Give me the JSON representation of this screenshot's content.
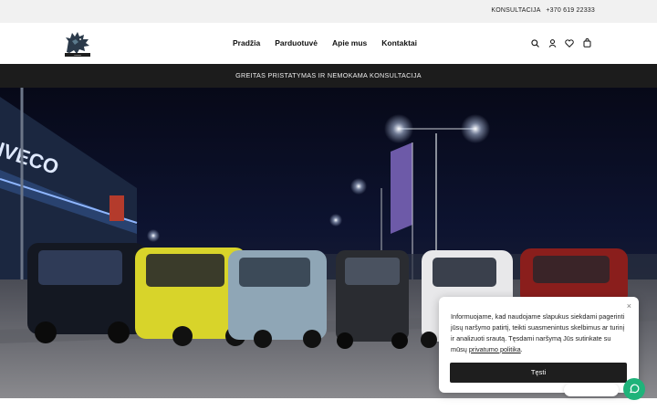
{
  "topbar": {
    "label": "KONSULTACIJA",
    "phone": "+370 619 22333"
  },
  "header": {
    "logo_icon": "dragon-logo-icon",
    "nav": [
      {
        "label": "Pradžia"
      },
      {
        "label": "Parduotuvė"
      },
      {
        "label": "Apie mus"
      },
      {
        "label": "Kontaktai"
      }
    ],
    "icons": [
      "search-icon",
      "account-icon",
      "wishlist-heart-icon",
      "cart-bag-icon"
    ]
  },
  "announcement": {
    "icon": "",
    "text": "GREITAS PRISTATYMAS IR NEMOKAMA KONSULTACIJA"
  },
  "hero": {
    "building_sign": "IVECO",
    "image": "row of small electric city cars at night in a parking lot"
  },
  "cookie": {
    "text": "Informuojame, kad naudojame slapukus siekdami pagerinti jūsų naršymo patirtį, teikti suasmenintus skelbimus ar turinį ir analizuoti srautą. Tęsdami naršymą Jūs sutinkate su mūsų",
    "link": "privatumo politika",
    "link_suffix": ".",
    "button": "Tęsti",
    "close": "×"
  },
  "colors": {
    "topbar_bg": "#f1f1f1",
    "announce_bg": "#1c1c1c",
    "chat": "#1fb37a",
    "button": "#1e1e1e"
  }
}
